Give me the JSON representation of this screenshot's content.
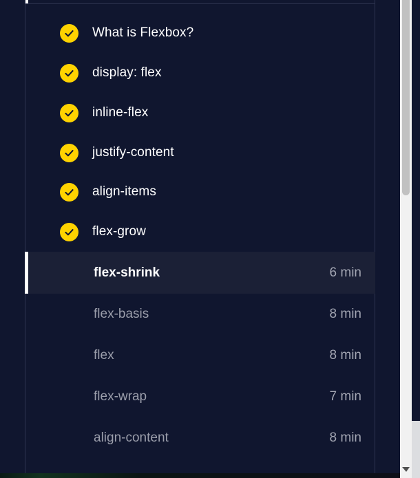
{
  "lessons": {
    "completed": [
      {
        "label": "What is Flexbox?"
      },
      {
        "label": "display: flex"
      },
      {
        "label": "inline-flex"
      },
      {
        "label": "justify-content"
      },
      {
        "label": "align-items"
      },
      {
        "label": "flex-grow"
      }
    ],
    "current": {
      "label": "flex-shrink",
      "duration": "6 min"
    },
    "upcoming": [
      {
        "label": "flex-basis",
        "duration": "8 min"
      },
      {
        "label": "flex",
        "duration": "8 min"
      },
      {
        "label": "flex-wrap",
        "duration": "7 min"
      },
      {
        "label": "align-content",
        "duration": "8 min"
      }
    ]
  },
  "icons": {
    "completed": "check-circle-icon",
    "scroll_down": "scroll-down-arrow-icon"
  },
  "colors": {
    "background": "#10162f",
    "check_fill": "#ffd300",
    "current_row": "#1b2036",
    "muted_text": "#9b9eab"
  }
}
